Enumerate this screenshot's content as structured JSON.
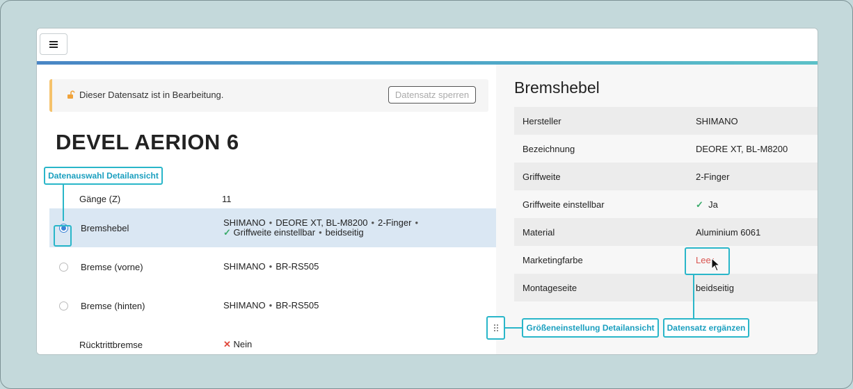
{
  "notice": {
    "text": "Dieser Datensatz ist in Bearbeitung.",
    "lock_button": "Datensatz sperren"
  },
  "record": {
    "title": "DEVEL AERION 6"
  },
  "rows": [
    {
      "label": "Gänge (Z)",
      "value": "11"
    },
    {
      "label": "Bremshebel",
      "v1": "SHIMANO",
      "v2": "DEORE XT, BL-M8200",
      "v3": "2-Finger",
      "v4": "Griffweite einstellbar",
      "v5": "beidseitig",
      "selected": true
    },
    {
      "label": "Bremse (vorne)",
      "v1": "SHIMANO",
      "v2": "BR-RS505"
    },
    {
      "label": "Bremse (hinten)",
      "v1": "SHIMANO",
      "v2": "BR-RS505"
    },
    {
      "label": "Rücktrittbremse",
      "value": "Nein"
    }
  ],
  "detail": {
    "title": "Bremshebel",
    "rows": [
      {
        "label": "Hersteller",
        "value": "SHIMANO"
      },
      {
        "label": "Bezeichnung",
        "value": "DEORE XT, BL-M8200"
      },
      {
        "label": "Griffweite",
        "value": "2-Finger"
      },
      {
        "label": "Griffweite einstellbar",
        "value": "Ja"
      },
      {
        "label": "Material",
        "value": "Aluminium 6061"
      },
      {
        "label": "Marketingfarbe",
        "value": "Leer"
      },
      {
        "label": "Montageseite",
        "value": "beidseitig"
      }
    ]
  },
  "callouts": {
    "datenauswahl": "Datenauswahl Detailansicht",
    "groesse": "Größeneinstellung Detailansicht",
    "ergaenzen": "Datensatz ergänzen"
  },
  "colors": {
    "accent": "#29b6c9",
    "selected_row": "#dae7f3",
    "notice_border": "#f5c26b",
    "empty_value": "#d9534f"
  },
  "icons": {
    "menu": "hamburger-icon",
    "lock": "unlock-icon",
    "check": "check-icon",
    "cross": "x-icon",
    "resize": "drag-handle-icon",
    "cursor": "mouse-pointer-icon"
  }
}
